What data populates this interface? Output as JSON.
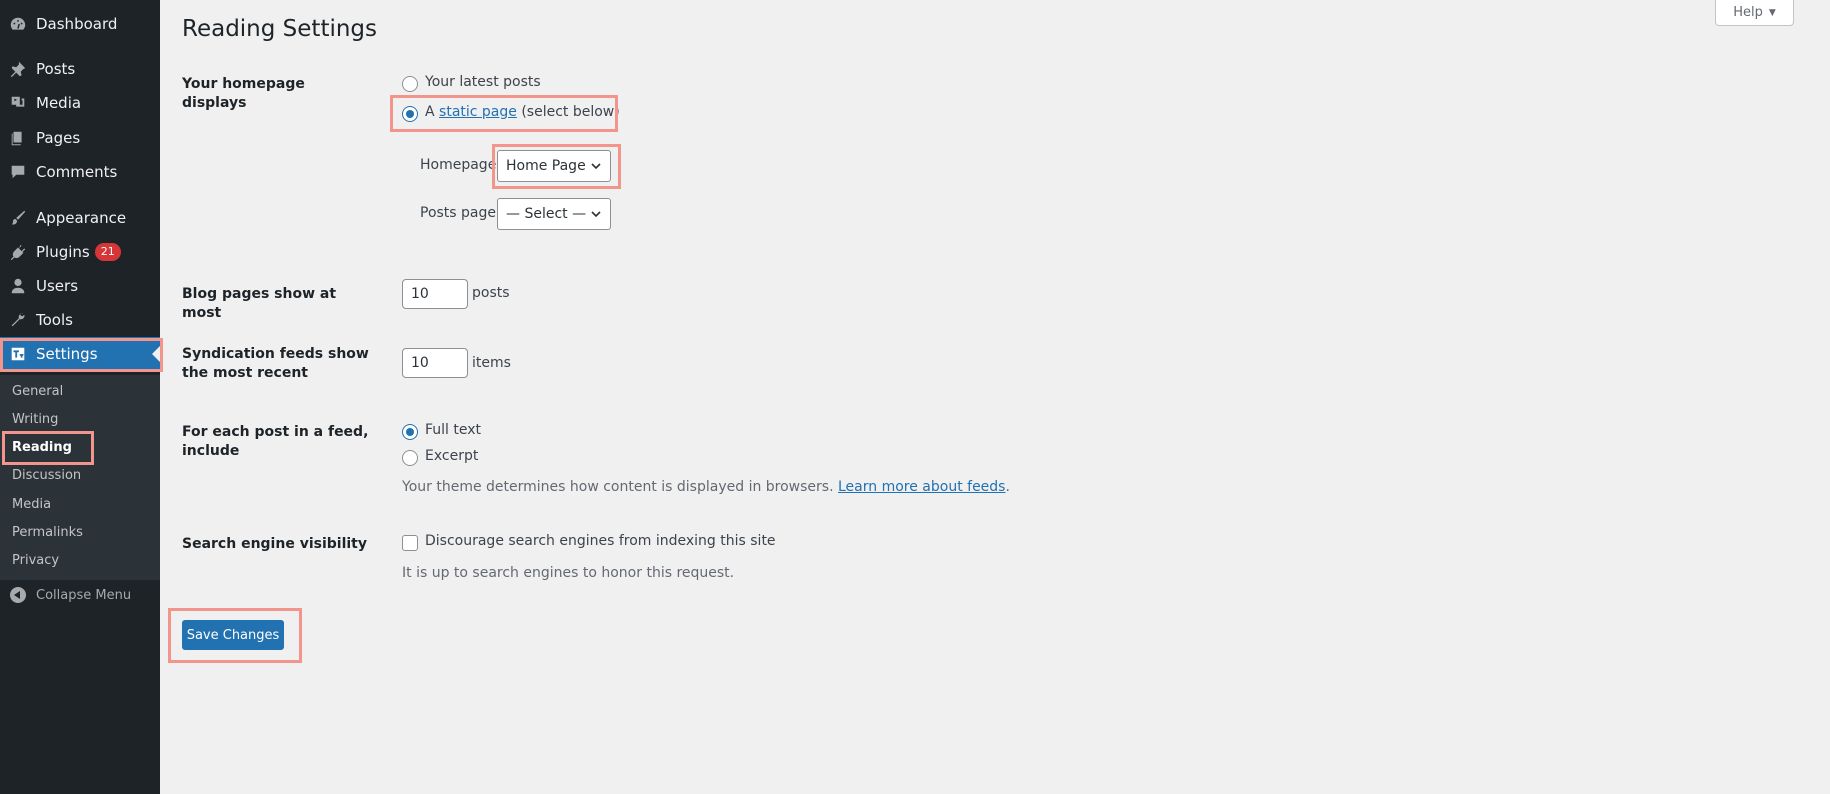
{
  "sidebar": {
    "items": [
      {
        "label": "Dashboard",
        "icon": "dashboard-icon"
      },
      {
        "label": "Posts",
        "icon": "pin-icon"
      },
      {
        "label": "Media",
        "icon": "media-icon"
      },
      {
        "label": "Pages",
        "icon": "pages-icon"
      },
      {
        "label": "Comments",
        "icon": "comment-icon"
      },
      {
        "label": "Appearance",
        "icon": "brush-icon"
      },
      {
        "label": "Plugins",
        "icon": "plugin-icon",
        "badge": "21"
      },
      {
        "label": "Users",
        "icon": "user-icon"
      },
      {
        "label": "Tools",
        "icon": "wrench-icon"
      },
      {
        "label": "Settings",
        "icon": "settings-icon",
        "active": true
      }
    ],
    "submenu": [
      "General",
      "Writing",
      "Reading",
      "Discussion",
      "Media",
      "Permalinks",
      "Privacy"
    ],
    "submenu_current": "Reading",
    "collapse_label": "Collapse Menu"
  },
  "header": {
    "title": "Reading Settings",
    "help_label": "Help"
  },
  "form": {
    "homepage_displays": {
      "label": "Your homepage displays",
      "option_latest": "Your latest posts",
      "option_static_prefix": "A",
      "option_static_link": "static page",
      "option_static_suffix": "(select below)",
      "selected": "static",
      "homepage_label": "Homepage:",
      "homepage_value": "Home Page",
      "posts_page_label": "Posts page:",
      "posts_page_value": "— Select —"
    },
    "blog_pages": {
      "label": "Blog pages show at most",
      "value": "10",
      "unit": "posts"
    },
    "syndication": {
      "label": "Syndication feeds show the most recent",
      "value": "10",
      "unit": "items"
    },
    "feed_content": {
      "label": "For each post in a feed, include",
      "option_full": "Full text",
      "option_excerpt": "Excerpt",
      "selected": "full",
      "description": "Your theme determines how content is displayed in browsers.",
      "link": "Learn more about feeds",
      "link_suffix": "."
    },
    "search_visibility": {
      "label": "Search engine visibility",
      "checkbox_label": "Discourage search engines from indexing this site",
      "checked": false,
      "description": "It is up to search engines to honor this request."
    },
    "save_label": "Save Changes"
  },
  "colors": {
    "sidebar_bg": "#1d2327",
    "submenu_bg": "#2c3338",
    "accent": "#2271b1",
    "highlight": "#f2958c",
    "badge": "#d63638"
  }
}
